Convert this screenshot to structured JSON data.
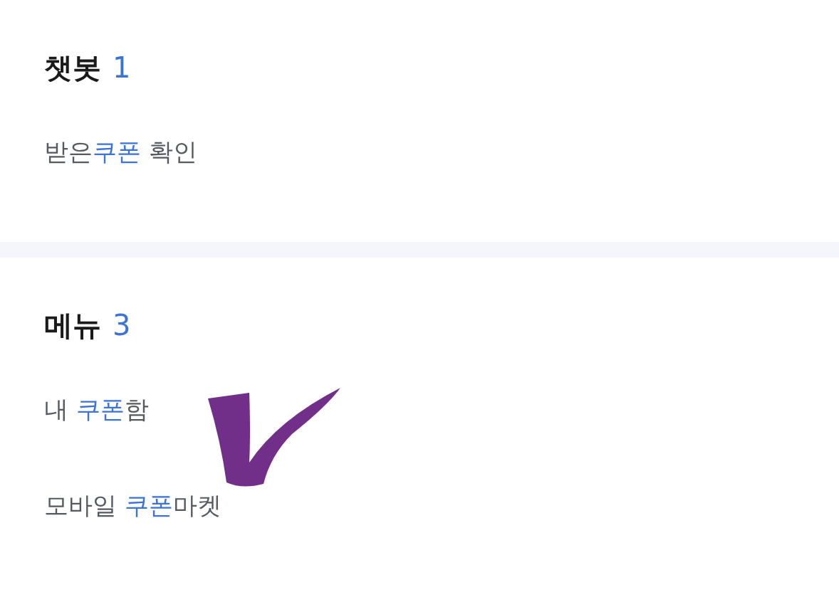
{
  "sections": [
    {
      "title": "챗봇",
      "count": "1",
      "items": [
        [
          {
            "text": "받은",
            "highlight": false
          },
          {
            "text": "쿠폰",
            "highlight": true
          },
          {
            "text": " 확인",
            "highlight": false
          }
        ]
      ]
    },
    {
      "title": "메뉴",
      "count": "3",
      "annotation": {
        "kind": "checkmark"
      },
      "items": [
        [
          {
            "text": "내 ",
            "highlight": false
          },
          {
            "text": "쿠폰",
            "highlight": true
          },
          {
            "text": "함",
            "highlight": false
          }
        ],
        [
          {
            "text": "모바일 ",
            "highlight": false
          },
          {
            "text": "쿠폰",
            "highlight": true
          },
          {
            "text": "마켓",
            "highlight": false
          }
        ]
      ]
    }
  ]
}
